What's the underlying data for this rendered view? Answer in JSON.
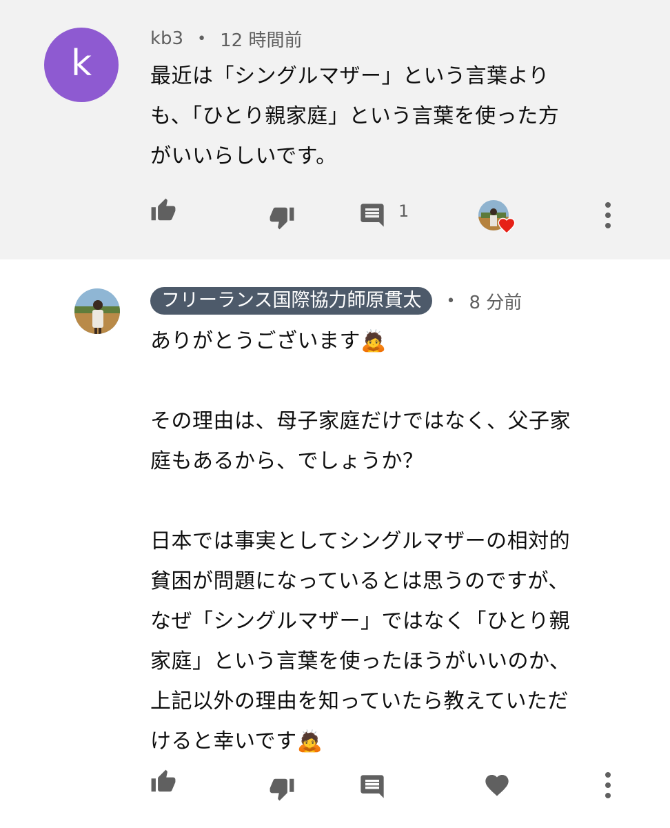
{
  "comments": [
    {
      "author": "kb3",
      "avatar_letter": "k",
      "time": "12 時間前",
      "text": "最近は「シングルマザー」という言葉より\nも、「ひとり親家庭」という言葉を使った方\nがいいらしいです。",
      "reply_count": "1",
      "hearted": true
    },
    {
      "author": "フリーランス国際協力師原貫太",
      "time": "8 分前",
      "text": "ありがとうございます🙇\n\nその理由は、母子家庭だけではなく、父子家\n庭もあるから、でしょうか？\n\n日本では事実としてシングルマザーの相対的\n貧困が問題になっているとは思うのですが、\nなぜ「シングルマザー」ではなく「ひとり親\n家庭」という言葉を使ったほうがいいのか、\n上記以外の理由を知っていたら教えていただ\nけると幸いです🙇",
      "is_owner": true
    }
  ],
  "separator": "•",
  "icons": {
    "like": "thumbs-up-icon",
    "dislike": "thumbs-down-icon",
    "reply": "comment-icon",
    "heart": "heart-icon",
    "more": "more-vert-icon"
  },
  "colors": {
    "avatar_purple": "#8e5ad1",
    "owner_chip": "#4d5a6a",
    "icon_gray": "#606060",
    "heart_red": "#e62117"
  }
}
